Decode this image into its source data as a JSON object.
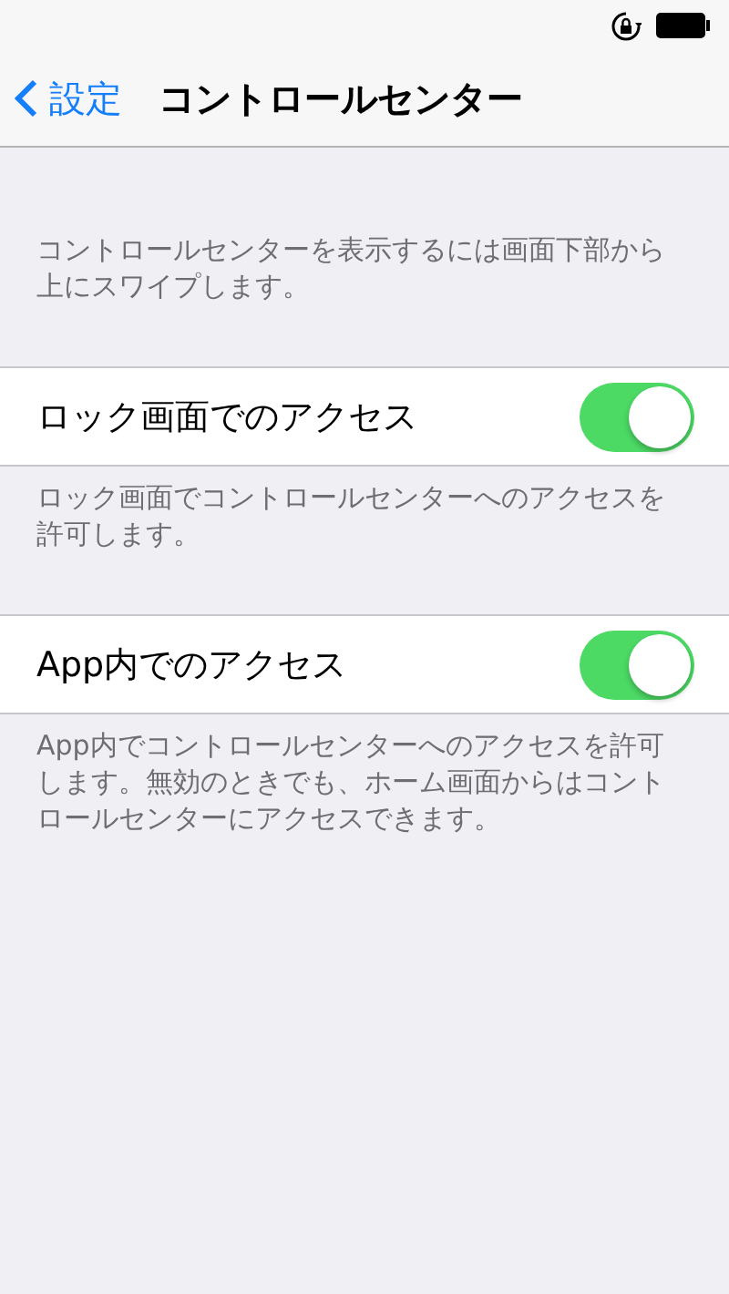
{
  "nav_bar": {
    "back_label": "設定",
    "title": "コントロールセンター"
  },
  "intro": "コントロールセンターを表示するには画面下部から上にスワイプします。",
  "settings": [
    {
      "label": "ロック画面でのアクセス",
      "on": true,
      "footer": "ロック画面でコントロールセンターへのアクセスを許可します。"
    },
    {
      "label": "App内でのアクセス",
      "on": true,
      "footer": "App内でコントロールセンターへのアクセスを許可します。無効のときでも、ホーム画面からはコントロールセンターにアクセスできます。"
    }
  ]
}
